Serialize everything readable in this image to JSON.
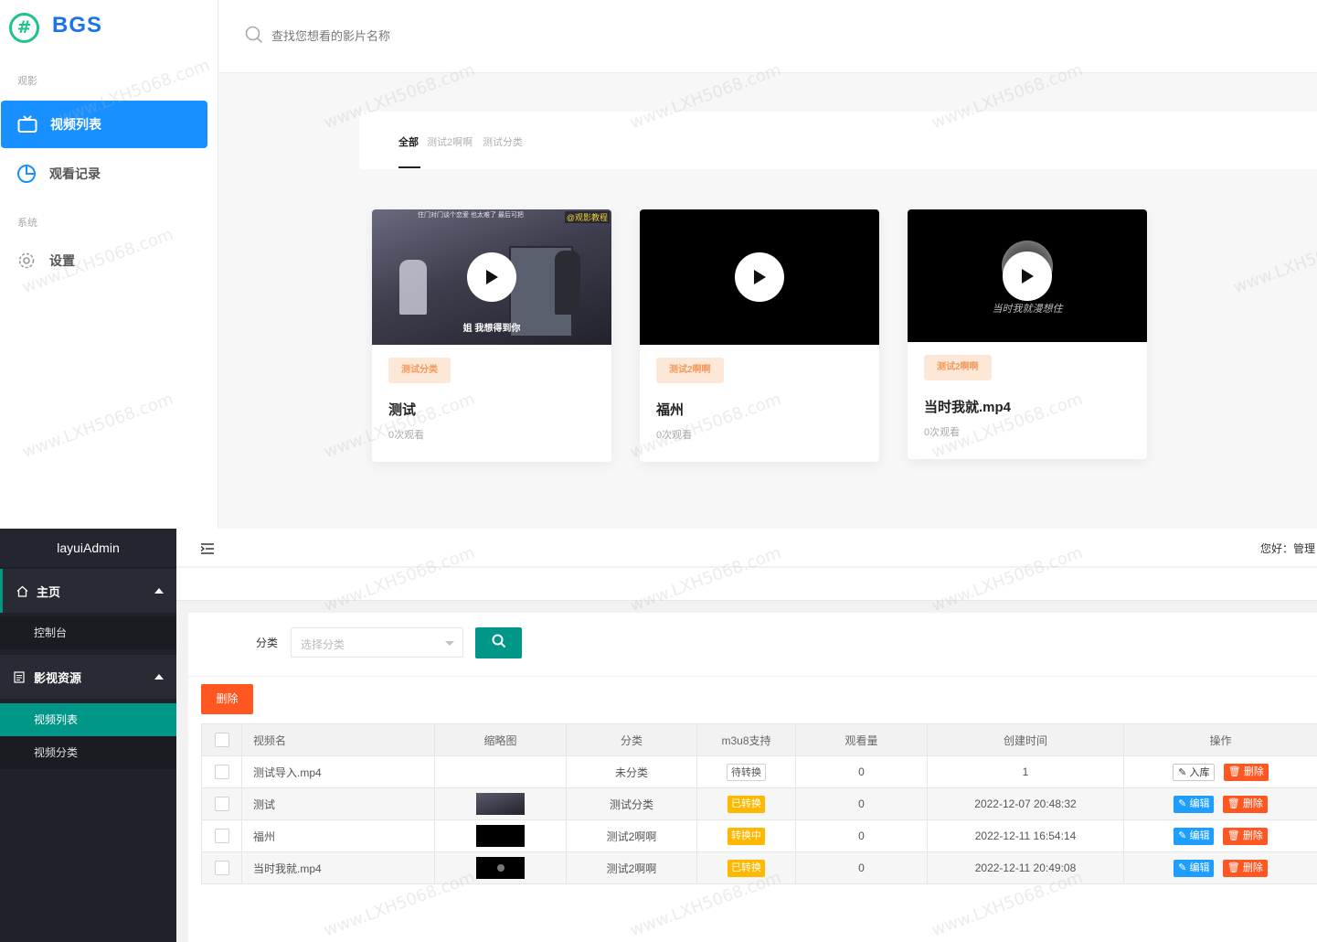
{
  "front": {
    "logo": {
      "mark": "#",
      "text": "BGS"
    },
    "sidebar": {
      "section_watch": "观影",
      "section_system": "系统",
      "items": [
        {
          "label": "视频列表",
          "icon": "tv-icon",
          "active": true
        },
        {
          "label": "观看记录",
          "icon": "pie-chart-icon",
          "active": false
        },
        {
          "label": "设置",
          "icon": "gear-icon",
          "active": false
        }
      ]
    },
    "search": {
      "placeholder": "查找您想看的影片名称",
      "icon": "search-icon"
    },
    "tabs": [
      "全部",
      "测试2啊啊",
      "测试分类"
    ],
    "videos": [
      {
        "tag": "测试分类",
        "title": "测试",
        "views": "0次观看",
        "caption_top": "住门对门谈个恋爱 也太难了 最后可把",
        "channel": "@观影教程",
        "subtitle": "姐 我想得到你"
      },
      {
        "tag": "测试2啊啊",
        "title": "福州",
        "views": "0次观看"
      },
      {
        "tag": "测试2啊啊",
        "title": "当时我就.mp4",
        "views": "0次观看",
        "handwriting": "当时我就漫想住"
      }
    ],
    "watermark": "www.LXH5068.com"
  },
  "admin": {
    "brand": "layuiAdmin",
    "nav": [
      {
        "label": "主页",
        "icon": "home-icon",
        "children": [
          "控制台"
        ]
      },
      {
        "label": "影视资源",
        "icon": "list-icon",
        "children": [
          "视频列表",
          "视频分类"
        ]
      }
    ],
    "active_sub": "视频列表",
    "greeting": "您好：管理",
    "filter": {
      "label": "分类",
      "placeholder": "选择分类"
    },
    "delete_label": "删除",
    "table": {
      "columns": [
        "视频名",
        "缩略图",
        "分类",
        "m3u8支持",
        "观看量",
        "创建时间",
        "操作"
      ],
      "rows": [
        {
          "name": "测试导入.mp4",
          "thumb": "none",
          "category": "未分类",
          "m3u8": "待转换",
          "m3u8_style": "outline",
          "views": "0",
          "created": "1",
          "actions": [
            "入库",
            "删除"
          ]
        },
        {
          "name": "测试",
          "thumb": "scene",
          "category": "测试分类",
          "m3u8": "已转换",
          "m3u8_style": "warn",
          "views": "0",
          "created": "2022-12-07 20:48:32",
          "actions": [
            "编辑",
            "删除"
          ]
        },
        {
          "name": "福州",
          "thumb": "black",
          "category": "测试2啊啊",
          "m3u8": "转换中",
          "m3u8_style": "warn",
          "views": "0",
          "created": "2022-12-11 16:54:14",
          "actions": [
            "编辑",
            "删除"
          ]
        },
        {
          "name": "当时我就.mp4",
          "thumb": "disc",
          "category": "测试2啊啊",
          "m3u8": "已转换",
          "m3u8_style": "warn",
          "views": "0",
          "created": "2022-12-11 20:49:08",
          "actions": [
            "编辑",
            "删除"
          ]
        }
      ]
    }
  },
  "colors": {
    "primary_blue": "#1890ff",
    "brand_green": "#1ec28b",
    "layui_teal": "#009688",
    "danger": "#ff5722",
    "warn": "#ffb800",
    "info": "#1e9fff",
    "tag_bg": "#fde8d8",
    "tag_fg": "#f39a5b"
  }
}
